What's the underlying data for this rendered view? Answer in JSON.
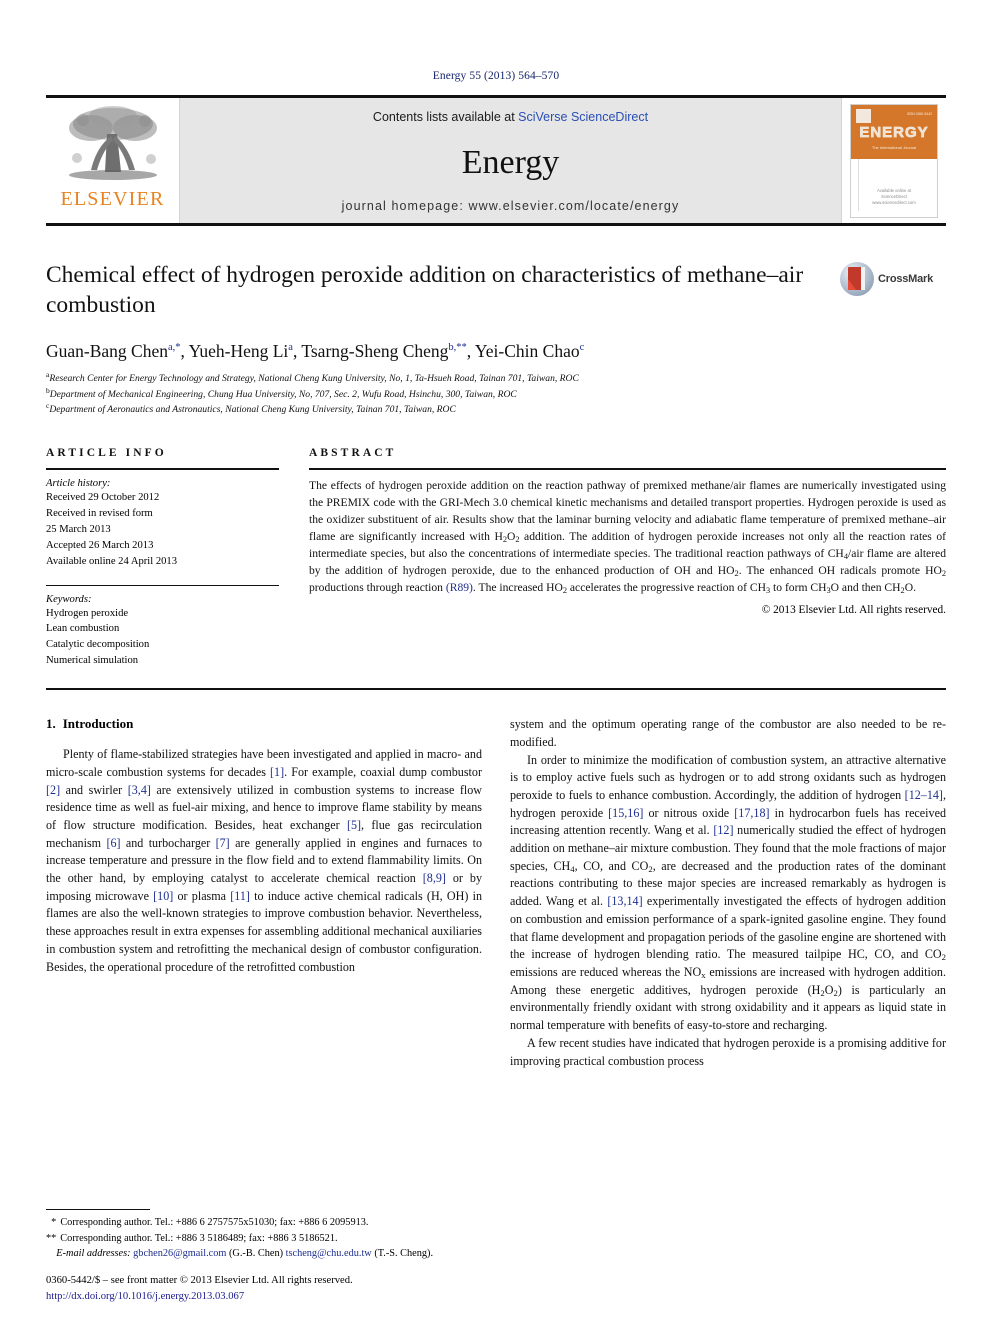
{
  "running_head": "Energy 55 (2013) 564–570",
  "masthead": {
    "publisher_name": "ELSEVIER",
    "contents_prefix": "Contents lists available at ",
    "contents_link": "SciVerse ScienceDirect",
    "journal_name": "Energy",
    "homepage": "journal homepage: www.elsevier.com/locate/energy",
    "cover": {
      "title": "ENERGY",
      "subtitle": "The International Journal",
      "footer_line1": "Available online at",
      "footer_line2": "ScienceDirect",
      "footer_line3": "www.sciencedirect.com"
    }
  },
  "article": {
    "title": "Chemical effect of hydrogen peroxide addition on characteristics of methane–air combustion",
    "crossmark_label": "CrossMark",
    "authors": [
      {
        "name": "Guan-Bang Chen",
        "marks": "a,*"
      },
      {
        "name": "Yueh-Heng Li",
        "marks": "a"
      },
      {
        "name": "Tsarng-Sheng Cheng",
        "marks": "b,**"
      },
      {
        "name": "Yei-Chin Chao",
        "marks": "c"
      }
    ],
    "affiliations": [
      {
        "mark": "a",
        "text": "Research Center for Energy Technology and Strategy, National Cheng Kung University, No, 1, Ta-Hsueh Road, Tainan 701, Taiwan, ROC"
      },
      {
        "mark": "b",
        "text": "Department of Mechanical Engineering, Chung Hua University, No, 707, Sec. 2, Wufu Road, Hsinchu, 300, Taiwan, ROC"
      },
      {
        "mark": "c",
        "text": "Department of Aeronautics and Astronautics, National Cheng Kung University, Tainan 701, Taiwan, ROC"
      }
    ]
  },
  "article_info": {
    "label": "ARTICLE INFO",
    "history_title": "Article history:",
    "history": [
      "Received 29 October 2012",
      "Received in revised form",
      "25 March 2013",
      "Accepted 26 March 2013",
      "Available online 24 April 2013"
    ],
    "keywords_title": "Keywords:",
    "keywords": [
      "Hydrogen peroxide",
      "Lean combustion",
      "Catalytic decomposition",
      "Numerical simulation"
    ]
  },
  "abstract": {
    "label": "ABSTRACT",
    "part1": "The effects of hydrogen peroxide addition on the reaction pathway of premixed methane/air flames are numerically investigated using the PREMIX code with the GRI-Mech 3.0 chemical kinetic mechanisms and detailed transport properties. Hydrogen peroxide is used as the oxidizer substituent of air. Results show that the laminar burning velocity and adiabatic flame temperature of premixed methane–air flame are significantly increased with H",
    "sub1": "2",
    "mid1": "O",
    "sub2": "2",
    "part2": " addition. The addition of hydrogen peroxide increases not only all the reaction rates of intermediate species, but also the concentrations of intermediate species. The traditional reaction pathways of CH",
    "sub3": "4",
    "part3": "/air flame are altered by the addition of hydrogen peroxide, due to the enhanced production of OH and HO",
    "sub4": "2",
    "part4": ". The enhanced OH radicals promote HO",
    "sub5": "2",
    "part5": " productions through reaction ",
    "reaction_link": "(R89)",
    "part6": ". The increased HO",
    "sub6": "2",
    "part7": " accelerates the progressive reaction of CH",
    "sub7": "3",
    "part8": " to form CH",
    "sub8": "3",
    "part9": "O and then CH",
    "sub9": "2",
    "part10": "O.",
    "copyright": "© 2013 Elsevier Ltd. All rights reserved."
  },
  "introduction": {
    "heading_number": "1.",
    "heading_title": "Introduction",
    "left_paragraph_1": {
      "t1": "Plenty of flame-stabilized strategies have been investigated and applied in macro- and micro-scale combustion systems for decades ",
      "r1": "[1]",
      "t2": ". For example, coaxial dump combustor ",
      "r2": "[2]",
      "t3": " and swirler ",
      "r3": "[3,4]",
      "t4": " are extensively utilized in combustion systems to increase flow residence time as well as fuel-air mixing, and hence to improve flame stability by means of flow structure modification. Besides, heat exchanger ",
      "r4": "[5]",
      "t5": ", flue gas recirculation mechanism ",
      "r5": "[6]",
      "t6": " and turbocharger ",
      "r6": "[7]",
      "t7": " are generally applied in engines and furnaces to increase temperature and pressure in the flow field and to extend flammability limits. On the other hand, by employing catalyst to accelerate chemical reaction ",
      "r7": "[8,9]",
      "t8": " or by imposing microwave ",
      "r8": "[10]",
      "t9": " or plasma ",
      "r9": "[11]",
      "t10": " to induce active chemical radicals (H, OH) in flames are also the well-known strategies to improve combustion behavior. Nevertheless, these approaches result in extra expenses for assembling additional mechanical auxiliaries in combustion system and retrofitting the mechanical design of combustor configuration. Besides, the operational procedure of the retrofitted combustion"
    },
    "right_paragraph_cont": "system and the optimum operating range of the combustor are also needed to be re-modified.",
    "right_paragraph_2": {
      "t1": "In order to minimize the modification of combustion system, an attractive alternative is to employ active fuels such as hydrogen or to add strong oxidants such as hydrogen peroxide to fuels to enhance combustion. Accordingly, the addition of hydrogen ",
      "r1": "[12–14]",
      "t2": ", hydrogen peroxide ",
      "r2": "[15,16]",
      "t3": " or nitrous oxide ",
      "r3": "[17,18]",
      "t4": " in hydrocarbon fuels has received increasing attention recently. Wang et al. ",
      "r4": "[12]",
      "t5": " numerically studied the effect of hydrogen addition on methane–air mixture combustion. They found that the mole fractions of major species, CH",
      "s1": "4",
      "t6": ", CO, and CO",
      "s2": "2",
      "t7": ", are decreased and the production rates of the dominant reactions contributing to these major species are increased remarkably as hydrogen is added. Wang et al. ",
      "r5": "[13,14]",
      "t8": " experimentally investigated the effects of hydrogen addition on combustion and emission performance of a spark-ignited gasoline engine. They found that flame development and propagation periods of the gasoline engine are shortened with the increase of hydrogen blending ratio. The measured tailpipe HC, CO, and CO",
      "s3": "2",
      "t9": " emissions are reduced whereas the NO",
      "s4": "x",
      "t10": " emissions are increased with hydrogen addition. Among these energetic additives, hydrogen peroxide (H",
      "s5": "2",
      "t11": "O",
      "s6": "2",
      "t12": ") is particularly an environmentally friendly oxidant with strong oxidability and it appears as liquid state in normal temperature with benefits of easy-to-store and recharging."
    },
    "right_paragraph_3": "A few recent studies have indicated that hydrogen peroxide is a promising additive for improving practical combustion process"
  },
  "footnotes": {
    "line1_mark": "*",
    "line1": "Corresponding author. Tel.: +886 6 2757575x51030; fax: +886 6 2095913.",
    "line2_mark": "**",
    "line2": "Corresponding author. Tel.: +886 3 5186489; fax: +886 3 5186521.",
    "email_label": "E-mail addresses:",
    "email1": "gbchen26@gmail.com",
    "email1_owner": "(G.-B. Chen)",
    "email2": "tscheng@chu.edu.tw",
    "email2_owner": "(T.-S. Cheng).",
    "imprint": "0360-5442/$ – see front matter © 2013 Elsevier Ltd. All rights reserved.",
    "doi": "http://dx.doi.org/10.1016/j.energy.2013.03.067"
  }
}
